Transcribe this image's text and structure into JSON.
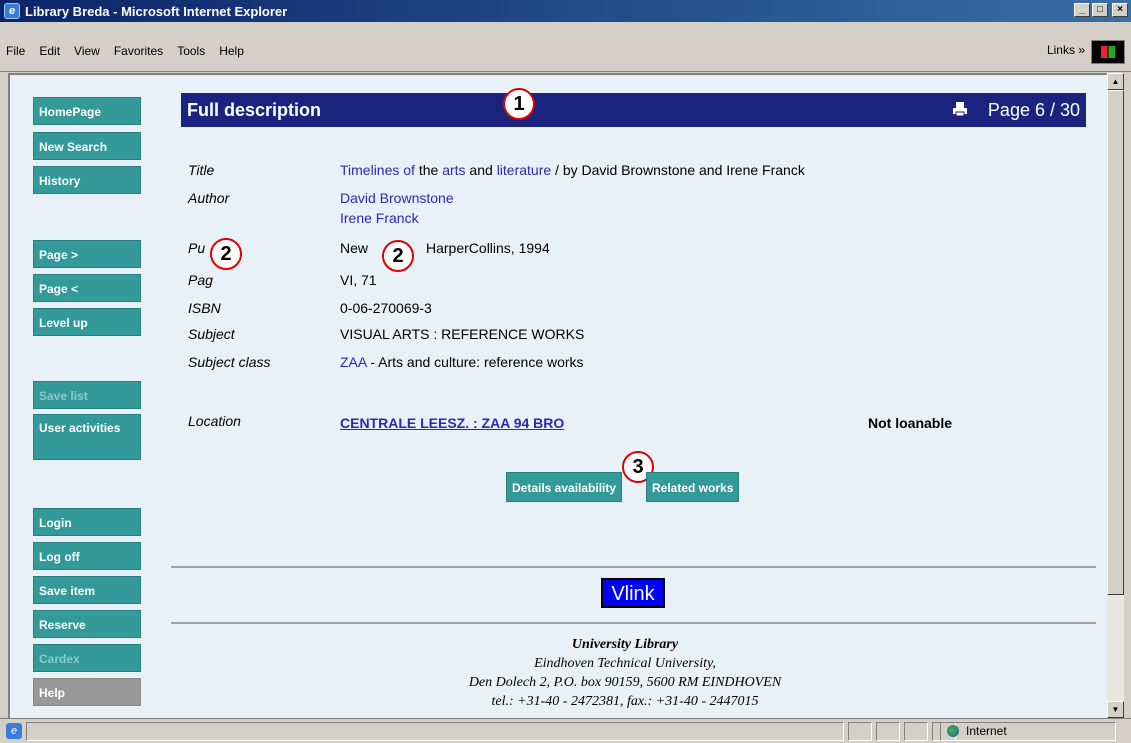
{
  "window": {
    "title": "Library Breda - Microsoft Internet Explorer",
    "menus": [
      "File",
      "Edit",
      "View",
      "Favorites",
      "Tools",
      "Help"
    ],
    "links_label": "Links »"
  },
  "sidebar": {
    "items": [
      {
        "label": "HomePage",
        "state": "enabled"
      },
      {
        "label": "New Search",
        "state": "enabled"
      },
      {
        "label": "History",
        "state": "enabled"
      },
      {
        "label": "Page >",
        "state": "enabled"
      },
      {
        "label": "Page <",
        "state": "enabled"
      },
      {
        "label": "Level up",
        "state": "enabled"
      },
      {
        "label": "Save list",
        "state": "disabled"
      },
      {
        "label": "User activities",
        "state": "enabled"
      },
      {
        "label": "Login",
        "state": "enabled"
      },
      {
        "label": "Log off",
        "state": "enabled"
      },
      {
        "label": "Save item",
        "state": "enabled"
      },
      {
        "label": "Reserve",
        "state": "enabled"
      },
      {
        "label": "Cardex",
        "state": "disabled"
      },
      {
        "label": "Help",
        "state": "grey"
      }
    ]
  },
  "header": {
    "title": "Full description",
    "page_count": "Page 6 / 30",
    "print_icon": "printer-icon"
  },
  "callouts": [
    "1",
    "2",
    "2",
    "3"
  ],
  "record": {
    "title_label": "Title",
    "title_link1": "Timelines of",
    "title_text1": " the ",
    "title_link2": "arts",
    "title_text2": " and ",
    "title_link3": "literature",
    "title_text3": " / by David Brownstone and Irene Franck",
    "author_label": "Author",
    "authors": [
      "David Brownstone",
      "Irene Franck"
    ],
    "publisher_label_visible": "Pu",
    "publisher_value_start": "New",
    "publisher_value_end": "HarperCollins, 1994",
    "pages_label_visible": "Pag",
    "pages_value_visible": "VI, 71",
    "isbn_label": "ISBN",
    "isbn": "0-06-270069-3",
    "subject_label": "Subject",
    "subject": "VISUAL ARTS : REFERENCE WORKS",
    "subject_class_label": "Subject class",
    "subject_class_code": "ZAA",
    "subject_class_desc": " - Arts and culture: reference works",
    "location_label": "Location",
    "location": "CENTRALE LEESZ. : ZAA 94 BRO",
    "loan_status": "Not loanable"
  },
  "actions": {
    "details": "Details availability",
    "related": "Related works"
  },
  "vlink": "Vlink",
  "footer": {
    "line1": "University Library",
    "line2": "Eindhoven Technical University,",
    "line3": "Den Dolech 2, P.O. box 90159, 5600 RM EINDHOVEN",
    "line4": "tel.: +31-40 - 2472381, fax.: +31-40 - 2447015"
  },
  "status": {
    "zone": "Internet"
  },
  "colors": {
    "accent_teal": "#339999",
    "header_navy": "#1a237e",
    "link_blue": "#2a2ab0",
    "callout_red": "#e00000"
  }
}
